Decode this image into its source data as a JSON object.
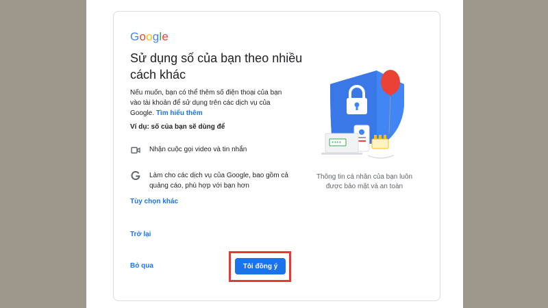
{
  "logo": {
    "letters": [
      "G",
      "o",
      "o",
      "g",
      "l",
      "e"
    ],
    "colors": [
      "#4285f4",
      "#ea4335",
      "#fbbc05",
      "#4285f4",
      "#34a853",
      "#ea4335"
    ]
  },
  "title": "Sử dụng số của bạn theo nhiều cách khác",
  "intro": {
    "text": "Nếu muốn, bạn có thể thêm số điện thoại của bạn vào tài khoản để sử dụng trên các dịch vụ của Google. ",
    "link": "Tìm hiểu thêm"
  },
  "example_heading": "Ví dụ: số của bạn sẽ dùng để",
  "uses": [
    {
      "icon": "video-camera-icon",
      "text": "Nhận cuộc gọi video và tin nhắn"
    },
    {
      "icon": "google-g-icon",
      "text": "Làm cho các dịch vụ của Google, bao gồm cả quảng cáo, phù hợp với bạn hơn"
    }
  ],
  "more_options": "Tùy chọn khác",
  "back": "Trở lại",
  "skip": "Bỏ qua",
  "agree": "Tôi đồng ý",
  "caption": "Thông tin cá nhân của bạn luôn được bảo mật và an toàn",
  "colors": {
    "accent": "#1a73e8",
    "highlight": "#e53935",
    "background": "#9e978b"
  }
}
